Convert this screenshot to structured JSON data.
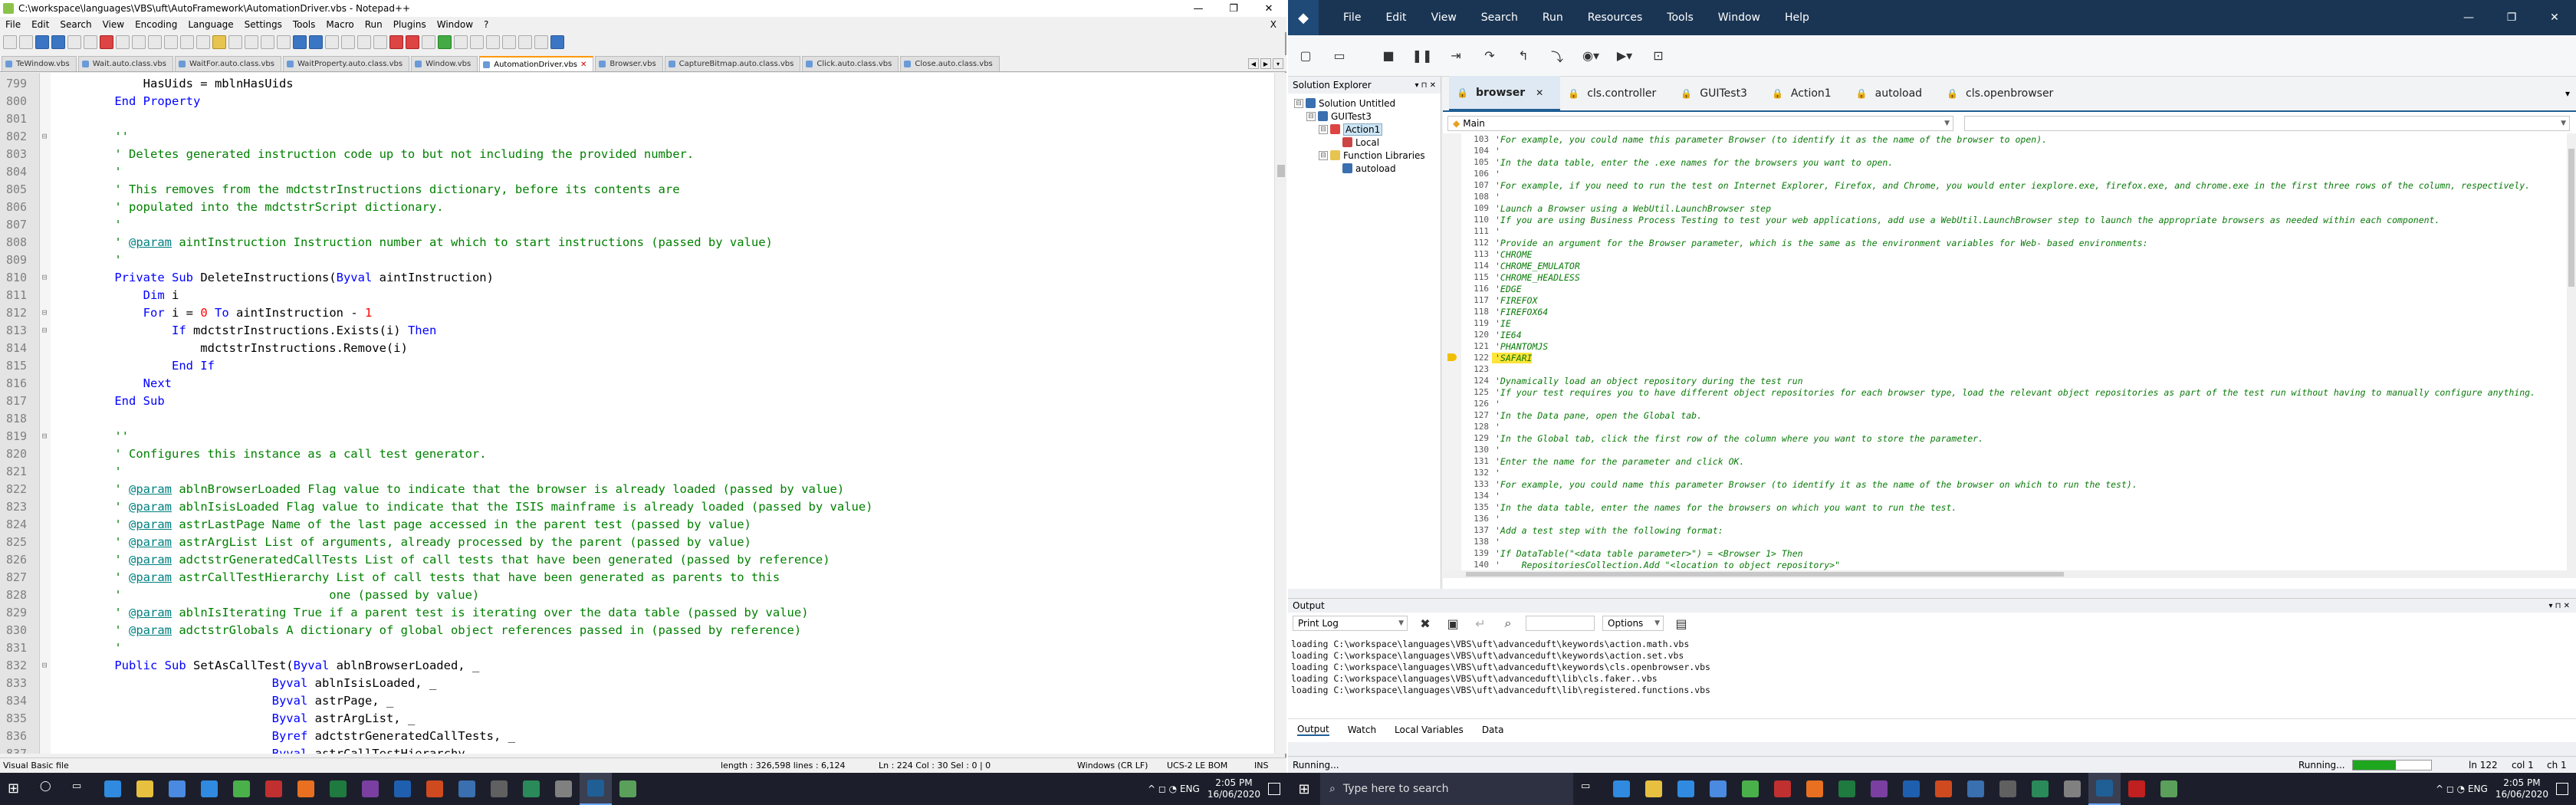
{
  "notepad": {
    "title": "C:\\workspace\\languages\\VBS\\uft\\AutoFramework\\AutomationDriver.vbs - Notepad++",
    "window_controls": [
      "—",
      "❐",
      "✕"
    ],
    "menu": [
      "File",
      "Edit",
      "Search",
      "View",
      "Encoding",
      "Language",
      "Settings",
      "Tools",
      "Macro",
      "Run",
      "Plugins",
      "Window",
      "?"
    ],
    "menu_close": "X",
    "tabs": [
      {
        "label": "TeWindow.vbs",
        "active": false
      },
      {
        "label": "Wait.auto.class.vbs",
        "active": false
      },
      {
        "label": "WaitFor.auto.class.vbs",
        "active": false
      },
      {
        "label": "WaitProperty.auto.class.vbs",
        "active": false
      },
      {
        "label": "Window.vbs",
        "active": false
      },
      {
        "label": "AutomationDriver.vbs",
        "active": true
      },
      {
        "label": "Browser.vbs",
        "active": false
      },
      {
        "label": "CaptureBitmap.auto.class.vbs",
        "active": false
      },
      {
        "label": "Click.auto.class.vbs",
        "active": false
      },
      {
        "label": "Close.auto.class.vbs",
        "active": false
      }
    ],
    "tab_close": "✕",
    "code_lines": [
      {
        "n": "799",
        "f": "",
        "html": "        HasUids = mblnHasUids"
      },
      {
        "n": "800",
        "f": "",
        "html": "    <span class=\"kw\">End Property</span>"
      },
      {
        "n": "801",
        "f": "",
        "html": ""
      },
      {
        "n": "802",
        "f": "⊟",
        "html": "    <span class=\"cm\">''</span>"
      },
      {
        "n": "803",
        "f": "",
        "html": "    <span class=\"cm\">' Deletes generated instruction code up to but not including the provided number.</span>"
      },
      {
        "n": "804",
        "f": "",
        "html": "    <span class=\"cm\">'</span>"
      },
      {
        "n": "805",
        "f": "",
        "html": "    <span class=\"cm\">' This removes from the mdctstrInstructions dictionary, before its contents are</span>"
      },
      {
        "n": "806",
        "f": "",
        "html": "    <span class=\"cm\">' populated into the mdctstrScript dictionary.</span>"
      },
      {
        "n": "807",
        "f": "",
        "html": "    <span class=\"cm\">'</span>"
      },
      {
        "n": "808",
        "f": "",
        "html": "    <span class=\"cm\">' <span class=\"tg\">@param</span> aintInstruction Instruction number at which to start instructions (passed by value)</span>"
      },
      {
        "n": "809",
        "f": "",
        "html": "    <span class=\"cm\">'</span>"
      },
      {
        "n": "810",
        "f": "⊟",
        "html": "    <span class=\"kw\">Private Sub</span> DeleteInstructions(<span class=\"kw\">Byval</span> aintInstruction)"
      },
      {
        "n": "811",
        "f": "",
        "html": "        <span class=\"kw\">Dim</span> i"
      },
      {
        "n": "812",
        "f": "⊟",
        "html": "        <span class=\"kw\">For</span> i = <span class=\"nm\">0</span> <span class=\"kw\">To</span> aintInstruction - <span class=\"nm\">1</span>"
      },
      {
        "n": "813",
        "f": "⊟",
        "html": "            <span class=\"kw\">If</span> mdctstrInstructions.Exists(i) <span class=\"kw\">Then</span>"
      },
      {
        "n": "814",
        "f": "",
        "html": "                mdctstrInstructions.Remove(i)"
      },
      {
        "n": "815",
        "f": "",
        "html": "            <span class=\"kw\">End If</span>"
      },
      {
        "n": "816",
        "f": "",
        "html": "        <span class=\"kw\">Next</span>"
      },
      {
        "n": "817",
        "f": "",
        "html": "    <span class=\"kw\">End Sub</span>"
      },
      {
        "n": "818",
        "f": "",
        "html": ""
      },
      {
        "n": "819",
        "f": "⊟",
        "html": "    <span class=\"cm\">''</span>"
      },
      {
        "n": "820",
        "f": "",
        "html": "    <span class=\"cm\">' Configures this instance as a call test generator.</span>"
      },
      {
        "n": "821",
        "f": "",
        "html": "    <span class=\"cm\">'</span>"
      },
      {
        "n": "822",
        "f": "",
        "html": "    <span class=\"cm\">' <span class=\"tg\">@param</span> ablnBrowserLoaded Flag value to indicate that the browser is already loaded (passed by value)</span>"
      },
      {
        "n": "823",
        "f": "",
        "html": "    <span class=\"cm\">' <span class=\"tg\">@param</span> ablnIsisLoaded Flag value to indicate that the ISIS mainframe is already loaded (passed by value)</span>"
      },
      {
        "n": "824",
        "f": "",
        "html": "    <span class=\"cm\">' <span class=\"tg\">@param</span> astrLastPage Name of the last page accessed in the parent test (passed by value)</span>"
      },
      {
        "n": "825",
        "f": "",
        "html": "    <span class=\"cm\">' <span class=\"tg\">@param</span> astrArgList List of arguments, already processed by the parent (passed by value)</span>"
      },
      {
        "n": "826",
        "f": "",
        "html": "    <span class=\"cm\">' <span class=\"tg\">@param</span> adctstrGeneratedCallTests List of call tests that have been generated (passed by reference)</span>"
      },
      {
        "n": "827",
        "f": "",
        "html": "    <span class=\"cm\">' <span class=\"tg\">@param</span> astrCallTestHierarchy List of call tests that have been generated as parents to this</span>"
      },
      {
        "n": "828",
        "f": "",
        "html": "    <span class=\"cm\">'                             one (passed by value)</span>"
      },
      {
        "n": "829",
        "f": "",
        "html": "    <span class=\"cm\">' <span class=\"tg\">@param</span> ablnIsIterating True if a parent test is iterating over the data table (passed by value)</span>"
      },
      {
        "n": "830",
        "f": "",
        "html": "    <span class=\"cm\">' <span class=\"tg\">@param</span> adctstrGlobals A dictionary of global object references passed in (passed by reference)</span>"
      },
      {
        "n": "831",
        "f": "",
        "html": "    <span class=\"cm\">'</span>"
      },
      {
        "n": "832",
        "f": "⊟",
        "html": "    <span class=\"kw\">Public Sub</span> SetAsCallTest(<span class=\"kw\">Byval</span> ablnBrowserLoaded, _"
      },
      {
        "n": "833",
        "f": "",
        "html": "                          <span class=\"kw\">Byval</span> ablnIsisLoaded, _"
      },
      {
        "n": "834",
        "f": "",
        "html": "                          <span class=\"kw\">Byval</span> astrPage, _"
      },
      {
        "n": "835",
        "f": "",
        "html": "                          <span class=\"kw\">Byval</span> astrArgList, _"
      },
      {
        "n": "836",
        "f": "",
        "html": "                          <span class=\"kw\">Byref</span> adctstrGeneratedCallTests, _"
      },
      {
        "n": "837",
        "f": "",
        "html": "                          <span class=\"kw\">Byval</span> astrCallTestHierarchy, _"
      }
    ],
    "status": {
      "lang": "Visual Basic file",
      "length": "length : 326,598    lines : 6,124",
      "pos": "Ln : 224    Col : 30    Sel : 0 | 0",
      "eol": "Windows (CR LF)",
      "enc": "UCS-2 LE BOM",
      "ins": "INS"
    }
  },
  "uft": {
    "menu": [
      "File",
      "Edit",
      "View",
      "Search",
      "Run",
      "Resources",
      "Tools",
      "Window",
      "Help"
    ],
    "window_controls": [
      "—",
      "❐",
      "✕"
    ],
    "solution_explorer": {
      "title": "Solution Explorer",
      "pins": "▾ ⊓ ✕",
      "tree": [
        {
          "label": "Solution Untitled",
          "indent": 0,
          "color": "#3a6fb0",
          "sel": false,
          "exp": "⊟"
        },
        {
          "label": "GUITest3",
          "indent": 1,
          "color": "#3a6fb0",
          "sel": false,
          "exp": "⊟"
        },
        {
          "label": "Action1",
          "indent": 2,
          "color": "#d44",
          "sel": true,
          "exp": "⊟"
        },
        {
          "label": "Local",
          "indent": 3,
          "color": "#c44",
          "sel": false,
          "exp": ""
        },
        {
          "label": "Function Libraries",
          "indent": 2,
          "color": "#e7c450",
          "sel": false,
          "exp": "⊟"
        },
        {
          "label": "autoload",
          "indent": 3,
          "color": "#3a6fb0",
          "sel": false,
          "exp": ""
        }
      ]
    },
    "doc_tabs": [
      {
        "label": "browser",
        "active": true,
        "close": "✕"
      },
      {
        "label": "cls.controller",
        "active": false,
        "close": ""
      },
      {
        "label": "GUITest3",
        "active": false,
        "close": ""
      },
      {
        "label": "Action1",
        "active": false,
        "close": ""
      },
      {
        "label": "autoload",
        "active": false,
        "close": ""
      },
      {
        "label": "cls.openbrowser",
        "active": false,
        "close": ""
      }
    ],
    "doc_tabs_more": "▾",
    "scope_combo": "Main",
    "code_lines": [
      {
        "n": "103",
        "t": "'For example, you could name this parameter Browser (to identify it as the name of the browser to open).",
        "hl": false
      },
      {
        "n": "104",
        "t": "'",
        "hl": false
      },
      {
        "n": "105",
        "t": "'In the data table, enter the .exe names for the browsers you want to open.",
        "hl": false
      },
      {
        "n": "106",
        "t": "'",
        "hl": false
      },
      {
        "n": "107",
        "t": "'For example, if you need to run the test on Internet Explorer, Firefox, and Chrome, you would enter iexplore.exe, firefox.exe, and chrome.exe in the first three rows of the column, respectively.",
        "hl": false
      },
      {
        "n": "108",
        "t": "'",
        "hl": false
      },
      {
        "n": "109",
        "t": "'Launch a Browser using a WebUtil.LaunchBrowser step",
        "hl": false
      },
      {
        "n": "110",
        "t": "'If you are using Business Process Testing to test your web applications, add use a WebUtil.LaunchBrowser step to launch the appropriate browsers as needed within each component.",
        "hl": false
      },
      {
        "n": "111",
        "t": "'",
        "hl": false
      },
      {
        "n": "112",
        "t": "'Provide an argument for the Browser parameter, which is the same as the environment variables for Web- based environments:",
        "hl": false
      },
      {
        "n": "113",
        "t": "'CHROME",
        "hl": false
      },
      {
        "n": "114",
        "t": "'CHROME_EMULATOR",
        "hl": false
      },
      {
        "n": "115",
        "t": "'CHROME_HEADLESS",
        "hl": false
      },
      {
        "n": "116",
        "t": "'EDGE",
        "hl": false
      },
      {
        "n": "117",
        "t": "'FIREFOX",
        "hl": false
      },
      {
        "n": "118",
        "t": "'FIREFOX64",
        "hl": false
      },
      {
        "n": "119",
        "t": "'IE",
        "hl": false
      },
      {
        "n": "120",
        "t": "'IE64",
        "hl": false
      },
      {
        "n": "121",
        "t": "'PHANTOMJS",
        "hl": false
      },
      {
        "n": "122",
        "t": "'SAFARI",
        "hl": true
      },
      {
        "n": "123",
        "t": "",
        "hl": false
      },
      {
        "n": "124",
        "t": "'Dynamically load an object repository during the test run",
        "hl": false
      },
      {
        "n": "125",
        "t": "'If your test requires you to have different object repositories for each browser type, load the relevant object repositories as part of the test run without having to manually configure anything.",
        "hl": false
      },
      {
        "n": "126",
        "t": "'",
        "hl": false
      },
      {
        "n": "127",
        "t": "'In the Data pane, open the Global tab.",
        "hl": false
      },
      {
        "n": "128",
        "t": "'",
        "hl": false
      },
      {
        "n": "129",
        "t": "'In the Global tab, click the first row of the column where you want to store the parameter.",
        "hl": false
      },
      {
        "n": "130",
        "t": "'",
        "hl": false
      },
      {
        "n": "131",
        "t": "'Enter the name for the parameter and click OK.",
        "hl": false
      },
      {
        "n": "132",
        "t": "'",
        "hl": false
      },
      {
        "n": "133",
        "t": "'For example, you could name this parameter Browser (to identify it as the name of the browser on which to run the test).",
        "hl": false
      },
      {
        "n": "134",
        "t": "'",
        "hl": false
      },
      {
        "n": "135",
        "t": "'In the data table, enter the names for the browsers on which you want to run the test.",
        "hl": false
      },
      {
        "n": "136",
        "t": "'",
        "hl": false
      },
      {
        "n": "137",
        "t": "'Add a test step with the following format:",
        "hl": false
      },
      {
        "n": "138",
        "t": "'",
        "hl": false
      },
      {
        "n": "139",
        "t": "'If DataTable(\"<data table parameter>\") = <Browser 1> Then",
        "hl": false
      },
      {
        "n": "140",
        "t": "'    RepositoriesCollection.Add \"<location to object repository>\"",
        "hl": false
      }
    ],
    "output": {
      "title": "Output",
      "pins": "▾ ⊓ ✕",
      "combo": "Print Log",
      "options_label": "Options",
      "lines": [
        "loading C:\\workspace\\languages\\VBS\\uft\\advanceduft\\keywords\\action.math.vbs",
        "loading C:\\workspace\\languages\\VBS\\uft\\advanceduft\\keywords\\action.set.vbs",
        "loading C:\\workspace\\languages\\VBS\\uft\\advanceduft\\keywords\\cls.openbrowser.vbs",
        "loading C:\\workspace\\languages\\VBS\\uft\\advanceduft\\lib\\cls.faker..vbs",
        "loading C:\\workspace\\languages\\VBS\\uft\\advanceduft\\lib\\registered.functions.vbs"
      ],
      "tabs": [
        "Output",
        "Watch",
        "Local Variables",
        "Data"
      ]
    },
    "status": {
      "left": "Running...",
      "right_label": "Running...",
      "progress": 0.55,
      "ln": "ln 122",
      "col": "col 1",
      "ch": "ch 1"
    }
  },
  "taskbar_left": {
    "icons": [
      {
        "name": "start",
        "color": "#ffffff"
      },
      {
        "name": "search",
        "color": "#ffffff"
      },
      {
        "name": "task-view",
        "color": "#ffffff"
      },
      {
        "name": "edge",
        "color": "#2f8ae0"
      },
      {
        "name": "explorer",
        "color": "#e8c040"
      },
      {
        "name": "store",
        "color": "#4a8ae0"
      },
      {
        "name": "vscode",
        "color": "#2f8ae0"
      },
      {
        "name": "chrome",
        "color": "#4ab04a"
      },
      {
        "name": "app-red",
        "color": "#c03030"
      },
      {
        "name": "firefox",
        "color": "#e87020"
      },
      {
        "name": "excel",
        "color": "#1f7a3f"
      },
      {
        "name": "onenote",
        "color": "#7a3fa0"
      },
      {
        "name": "outlook",
        "color": "#1f5fb0"
      },
      {
        "name": "powerpoint",
        "color": "#d04a20"
      },
      {
        "name": "app-blue",
        "color": "#3a6fb0"
      },
      {
        "name": "terminal",
        "color": "#606060"
      },
      {
        "name": "app-green",
        "color": "#2a8a5a"
      },
      {
        "name": "app-grey",
        "color": "#808080"
      },
      {
        "name": "uft",
        "color": "#1f5f95"
      },
      {
        "name": "notepad",
        "color": "#5aa05a"
      }
    ],
    "tray": "^ ◻ ◔ ENG",
    "time": "2:05 PM",
    "date": "16/06/2020"
  },
  "taskbar_right": {
    "search_placeholder": "Type here to search",
    "icons": [
      {
        "name": "task-view",
        "color": "#ffffff"
      },
      {
        "name": "edge",
        "color": "#2f8ae0"
      },
      {
        "name": "explorer",
        "color": "#e8c040"
      },
      {
        "name": "vscode",
        "color": "#2f8ae0"
      },
      {
        "name": "store",
        "color": "#4a8ae0"
      },
      {
        "name": "chrome",
        "color": "#4ab04a"
      },
      {
        "name": "app-red",
        "color": "#c03030"
      },
      {
        "name": "firefox",
        "color": "#e87020"
      },
      {
        "name": "excel",
        "color": "#1f7a3f"
      },
      {
        "name": "onenote",
        "color": "#7a3fa0"
      },
      {
        "name": "outlook",
        "color": "#1f5fb0"
      },
      {
        "name": "powerpoint",
        "color": "#d04a20"
      },
      {
        "name": "app-blue",
        "color": "#3a6fb0"
      },
      {
        "name": "terminal",
        "color": "#606060"
      },
      {
        "name": "app-green",
        "color": "#2a8a5a"
      },
      {
        "name": "app-grey",
        "color": "#808080"
      },
      {
        "name": "uft",
        "color": "#1f5f95"
      },
      {
        "name": "acrobat",
        "color": "#c02020"
      },
      {
        "name": "notepad",
        "color": "#5aa05a"
      }
    ],
    "tray": "^ ◻ ◔ ENG",
    "time": "2:05 PM",
    "date": "16/06/2020"
  }
}
